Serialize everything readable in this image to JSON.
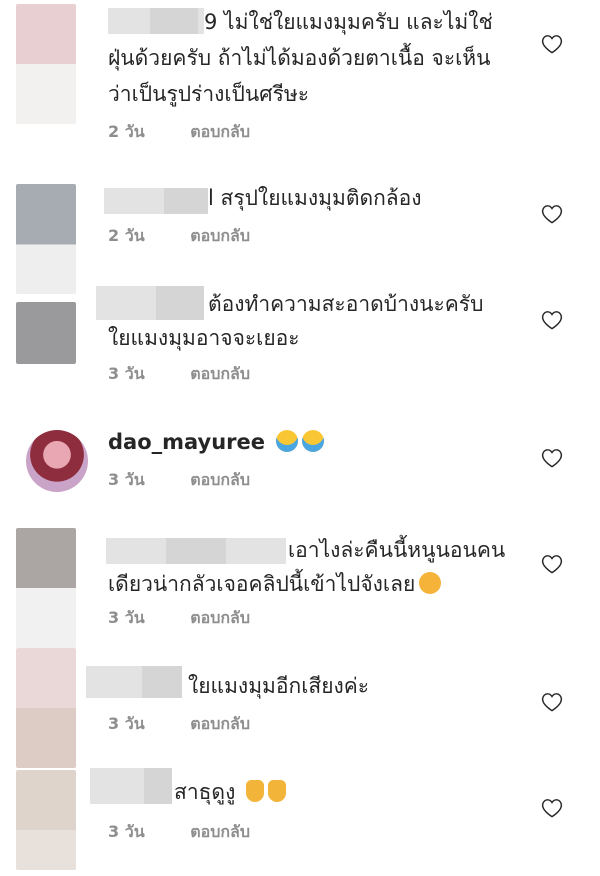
{
  "comments": [
    {
      "text_1": "9 ไม่ใช่ใยแมงมุมครับ  และไม่ใช่",
      "text_2": "ฝุ่นด้วยครับ  ถ้าไม่ได้มองด้วยตาเนื้อ จะเห็น",
      "text_3": "ว่าเป็นรูปร่างเป็นศรีษะ",
      "time": "2 วัน",
      "reply": "ตอบกลับ"
    },
    {
      "text_1": "l สรุปใยแมงมุมติดกล้อง",
      "time": "2 วัน",
      "reply": "ตอบกลับ"
    },
    {
      "text_1": "ต้องทำความสะอาดบ้างนะครับ",
      "text_2": "ใยแมงมุมอาจจะเยอะ",
      "time": "3 วัน",
      "reply": "ตอบกลับ"
    },
    {
      "username": "dao_mayuree",
      "emoji": [
        "face-screaming-in-fear",
        "face-screaming-in-fear"
      ],
      "time": "3 วัน",
      "reply": "ตอบกลับ"
    },
    {
      "text_1": "เอาไงล่ะคืนนี้หนูนอนคน",
      "text_2": "เดียวน่ากลัวเจอคลิปนี้เข้าไปจังเลย",
      "emoji": [
        "crying-face"
      ],
      "time": "3 วัน",
      "reply": "ตอบกลับ"
    },
    {
      "text_1": "ใยแมงมุมอีกเสียงค่ะ",
      "time": "3 วัน",
      "reply": "ตอบกลับ"
    },
    {
      "text_1": "สาธุดูงู",
      "emoji": [
        "folded-hands",
        "folded-hands"
      ],
      "time": "3 วัน",
      "reply": "ตอบกลับ"
    }
  ],
  "colors": {
    "text": "#262626",
    "meta": "#8e8e8e",
    "heart": "#262626"
  }
}
